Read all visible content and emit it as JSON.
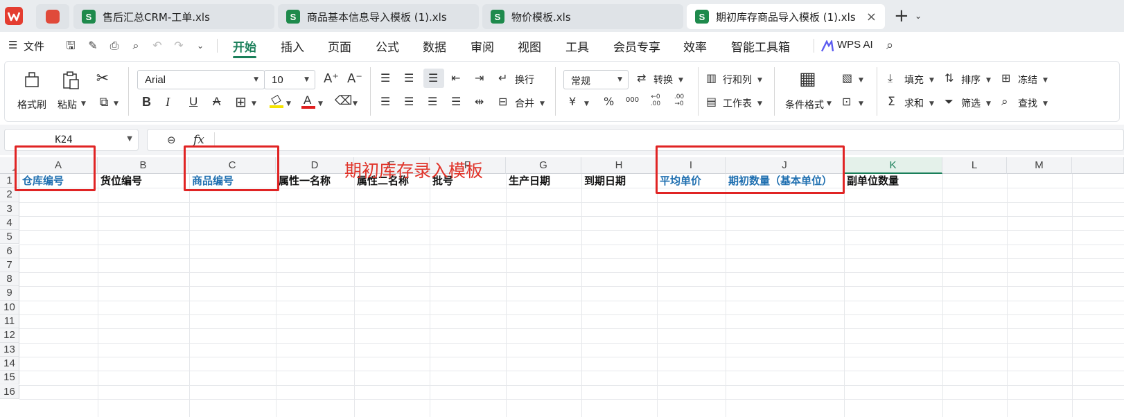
{
  "tabs": [
    {
      "label": "售后汇总CRM-工单.xls",
      "icon": "S"
    },
    {
      "label": "商品基本信息导入模板 (1).xls",
      "icon": "S"
    },
    {
      "label": "物价模板.xls",
      "icon": "S"
    },
    {
      "label": "期初库存商品导入模板 (1).xls",
      "icon": "S",
      "active": true
    }
  ],
  "menu": {
    "hamburger": "☰",
    "file": "文件",
    "items": [
      "开始",
      "插入",
      "页面",
      "公式",
      "数据",
      "审阅",
      "视图",
      "工具",
      "会员专享",
      "效率",
      "智能工具箱"
    ],
    "active": "开始",
    "wps_ai": "WPS AI"
  },
  "ribbon": {
    "format_painter": "格式刷",
    "paste": "粘贴",
    "font_name": "Arial",
    "font_size": "10",
    "wrap": "换行",
    "merge": "合并",
    "number_format": "常规",
    "convert": "转换",
    "rows_cols": "行和列",
    "worksheet": "工作表",
    "cond_format": "条件格式",
    "fill": "填充",
    "sort": "排序",
    "freeze": "冻结",
    "sum": "求和",
    "filter": "筛选",
    "find": "查找",
    "bold": "B",
    "italic": "I",
    "underline": "U",
    "strike": "A",
    "percent": "%",
    "yen": "¥",
    "thousands": "000",
    "inc_dec": "←0 .00",
    "dec_dec": ".00 →0"
  },
  "formula_bar": {
    "cell_ref": "K24",
    "fx": "fx",
    "value": ""
  },
  "sheet": {
    "columns": [
      "A",
      "B",
      "C",
      "D",
      "E",
      "F",
      "G",
      "H",
      "I",
      "J",
      "K",
      "L",
      "M"
    ],
    "selected_column": "K",
    "rows": [
      "1",
      "2",
      "3",
      "4",
      "5",
      "6",
      "7",
      "8",
      "9",
      "10",
      "11",
      "12",
      "13",
      "14",
      "15",
      "16"
    ],
    "header_cells": [
      {
        "col": "A",
        "text": "仓库编号",
        "highlight": true
      },
      {
        "col": "B",
        "text": "货位编号",
        "highlight": false
      },
      {
        "col": "C",
        "text": "商品编号",
        "highlight": true
      },
      {
        "col": "D",
        "text": "属性一名称",
        "highlight": false
      },
      {
        "col": "E",
        "text": "属性二名称",
        "highlight": false
      },
      {
        "col": "F",
        "text": "批号",
        "highlight": false
      },
      {
        "col": "G",
        "text": "生产日期",
        "highlight": false
      },
      {
        "col": "H",
        "text": "到期日期",
        "highlight": false
      },
      {
        "col": "I",
        "text": "平均单价",
        "highlight": true
      },
      {
        "col": "J",
        "text": "期初数量（基本单位）",
        "highlight": true
      },
      {
        "col": "K",
        "text": "副单位数量",
        "highlight": false
      }
    ]
  },
  "annotation": "期初库存录入模板",
  "colors": {
    "accent": "#1a7f5a",
    "highlight_text": "#1f6fb0",
    "annotation": "#e0342a"
  }
}
